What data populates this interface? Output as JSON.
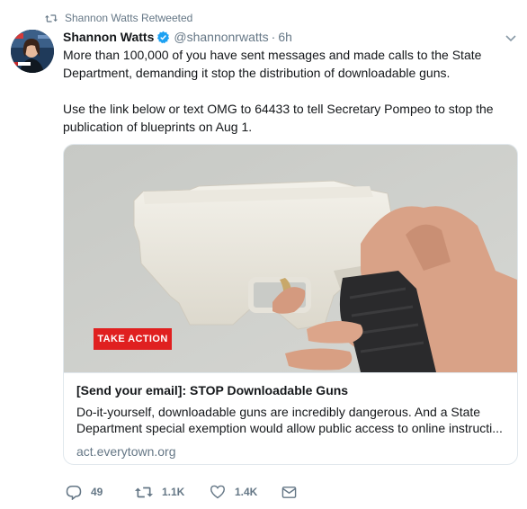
{
  "retweet_context": {
    "label": "Shannon Watts Retweeted",
    "icon": "retweet-icon"
  },
  "author": {
    "name": "Shannon Watts",
    "handle": "@shannonrwatts",
    "separator": "·",
    "time": "6h",
    "verified": true,
    "avatar_icon": "avatar-image"
  },
  "tweet": {
    "lines": [
      "More than 100,000 of you have sent messages and made calls to the State",
      "Department, demanding it stop the distribution of downloadable guns.",
      "Use the link below or text OMG to 64433 to tell Secretary Pompeo to stop the",
      "publication of blueprints on Aug 1."
    ]
  },
  "card": {
    "badge": "TAKE ACTION",
    "title": "[Send your email]: STOP Downloadable Guns",
    "description_lines": [
      "Do-it-yourself, downloadable guns are incredibly dangerous. And a State",
      "Department special exemption would allow public access to online instructi..."
    ],
    "domain": "act.everytown.org"
  },
  "actions": {
    "reply_count": "49",
    "retweet_count": "1.1K",
    "like_count": "1.4K",
    "icons": [
      "reply-icon",
      "retweet-icon",
      "like-icon",
      "direct-message-icon"
    ]
  },
  "colors": {
    "text": "#14171a",
    "muted": "#657786",
    "verified_blue": "#1da1f2",
    "badge_red": "#e02020",
    "border": "#e1e8ed"
  }
}
